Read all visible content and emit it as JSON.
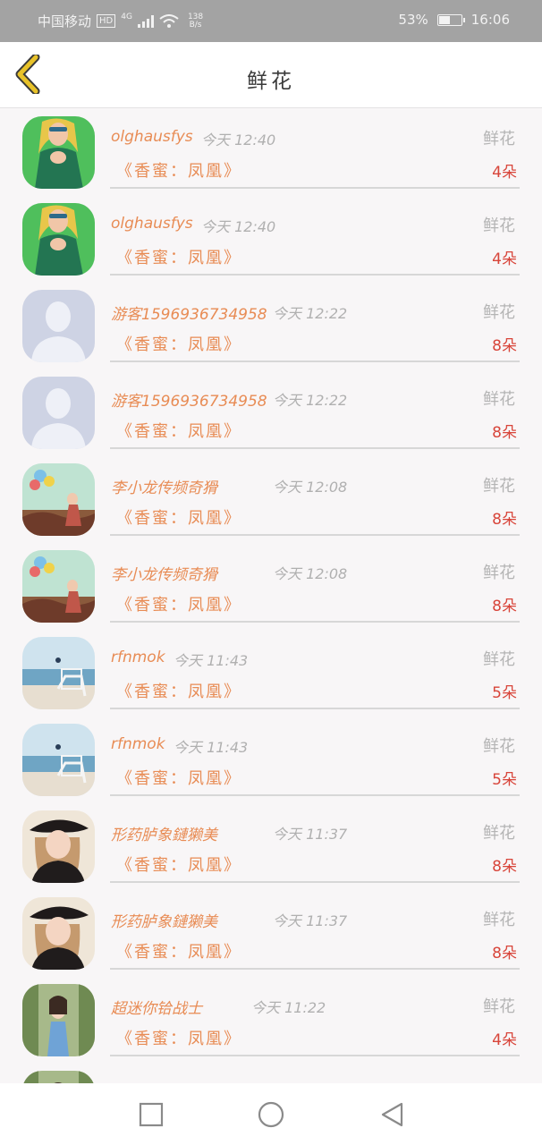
{
  "status_bar": {
    "carrier": "中国移动",
    "hd": "HD",
    "network": "4G",
    "speed_value": "138",
    "speed_unit": "B/s",
    "battery_percent": "53%",
    "battery_level": 0.53,
    "time": "16:06"
  },
  "header": {
    "title": "鲜花",
    "back_icon": "chevron-left-icon"
  },
  "records": [
    {
      "name": "olghausfys",
      "time": "今天 12:40",
      "type": "鲜花",
      "book": "《香蜜：凤凰》",
      "quantity": "4朵",
      "avatar": "woman-green-dress-avatar"
    },
    {
      "name": "olghausfys",
      "time": "今天 12:40",
      "type": "鲜花",
      "book": "《香蜜：凤凰》",
      "quantity": "4朵",
      "avatar": "woman-green-dress-avatar"
    },
    {
      "name": "游客1596936734958",
      "time": "今天 12:22",
      "type": "鲜花",
      "book": "《香蜜：凤凰》",
      "quantity": "8朵",
      "avatar": "default-user-avatar"
    },
    {
      "name": "游客1596936734958",
      "time": "今天 12:22",
      "type": "鲜花",
      "book": "《香蜜：凤凰》",
      "quantity": "8朵",
      "avatar": "default-user-avatar"
    },
    {
      "name": "李小龙传频奇猾",
      "time": "今天 12:08",
      "type": "鲜花",
      "book": "《香蜜：凤凰》",
      "quantity": "8朵",
      "avatar": "balloons-girl-avatar"
    },
    {
      "name": "李小龙传频奇猾",
      "time": "今天 12:08",
      "type": "鲜花",
      "book": "《香蜜：凤凰》",
      "quantity": "8朵",
      "avatar": "balloons-girl-avatar"
    },
    {
      "name": "rfnmok",
      "time": "今天 11:43",
      "type": "鲜花",
      "book": "《香蜜：凤凰》",
      "quantity": "5朵",
      "avatar": "seaside-chair-avatar"
    },
    {
      "name": "rfnmok",
      "time": "今天 11:43",
      "type": "鲜花",
      "book": "《香蜜：凤凰》",
      "quantity": "5朵",
      "avatar": "seaside-chair-avatar"
    },
    {
      "name": "形药胪象鏈獭美",
      "time": "今天 11:37",
      "type": "鲜花",
      "book": "《香蜜：凤凰》",
      "quantity": "8朵",
      "avatar": "girl-black-hat-avatar"
    },
    {
      "name": "形药胪象鏈獭美",
      "time": "今天 11:37",
      "type": "鲜花",
      "book": "《香蜜：凤凰》",
      "quantity": "8朵",
      "avatar": "girl-black-hat-avatar"
    },
    {
      "name": "超迷你铪战士",
      "time": "今天 11:22",
      "type": "鲜花",
      "book": "《香蜜：凤凰》",
      "quantity": "4朵",
      "avatar": "girl-garden-avatar"
    },
    {
      "name": "",
      "time": "",
      "type": "",
      "book": "",
      "quantity": "",
      "avatar": "girl-garden-avatar"
    }
  ],
  "nav_bar": {
    "recent_icon": "square-recent-apps-icon",
    "home_icon": "circle-home-icon",
    "back_icon": "triangle-back-icon"
  },
  "colors": {
    "accent": "#e88c55",
    "quantity": "#d8453a",
    "back_chevron": "#e8c229"
  }
}
